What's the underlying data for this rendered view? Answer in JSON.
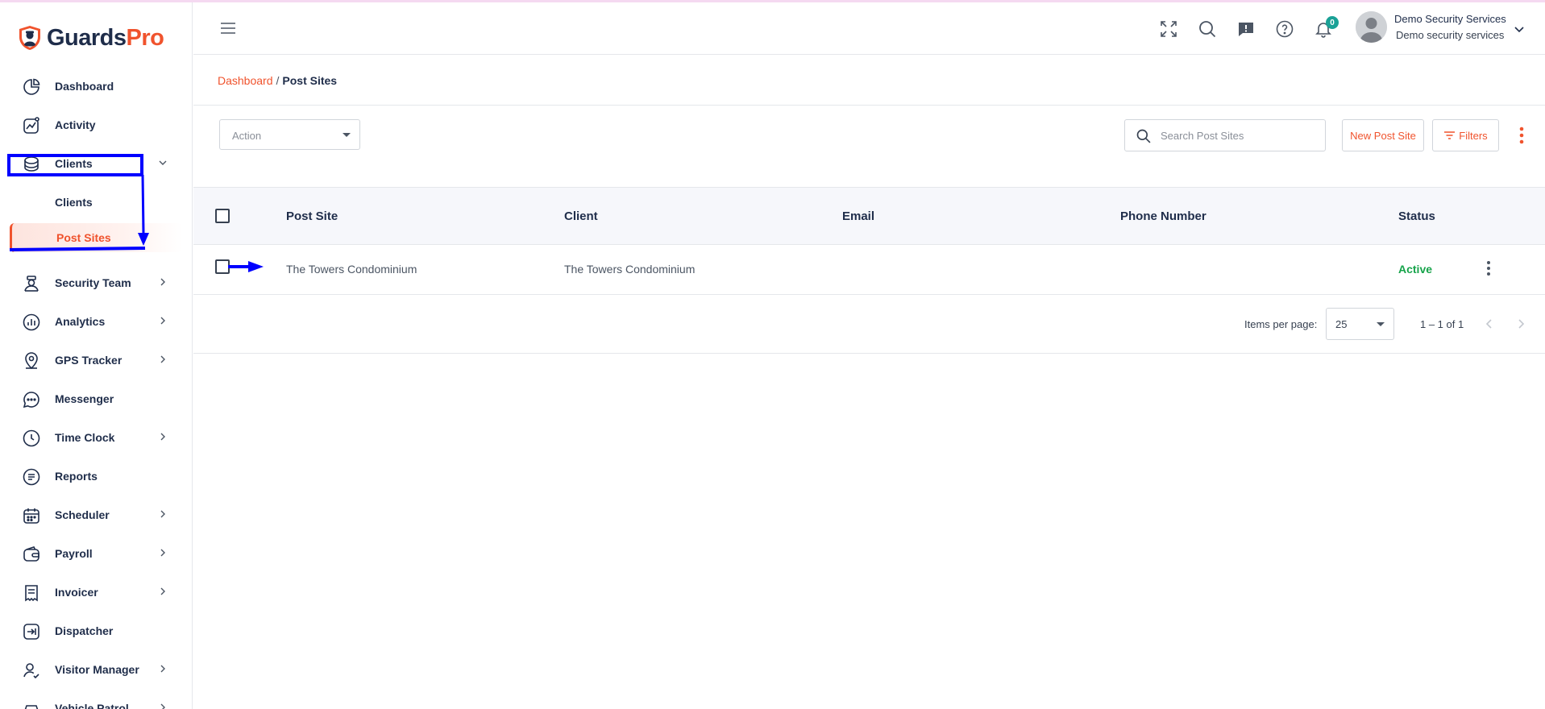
{
  "brand": {
    "name_part1": "Guards",
    "name_part2": "Pro",
    "primary_color": "#f0532d",
    "navy_color": "#1f2d4a"
  },
  "sidebar": {
    "items": [
      {
        "label": "Dashboard",
        "icon": "pie-chart-icon"
      },
      {
        "label": "Activity",
        "icon": "trend-chart-icon"
      },
      {
        "label": "Clients",
        "icon": "database-icon",
        "expanded": true,
        "children": [
          {
            "label": "Clients"
          },
          {
            "label": "Post Sites",
            "active": true
          }
        ]
      },
      {
        "label": "Security Team",
        "icon": "guard-icon"
      },
      {
        "label": "Analytics",
        "icon": "bar-chart-icon"
      },
      {
        "label": "GPS Tracker",
        "icon": "location-pin-icon"
      },
      {
        "label": "Messenger",
        "icon": "chat-bubble-icon"
      },
      {
        "label": "Time Clock",
        "icon": "clock-icon"
      },
      {
        "label": "Reports",
        "icon": "report-doc-icon"
      },
      {
        "label": "Scheduler",
        "icon": "calendar-icon"
      },
      {
        "label": "Payroll",
        "icon": "wallet-icon"
      },
      {
        "label": "Invoicer",
        "icon": "receipt-icon"
      },
      {
        "label": "Dispatcher",
        "icon": "dispatch-icon"
      },
      {
        "label": "Visitor Manager",
        "icon": "visitor-icon"
      },
      {
        "label": "Vehicle Patrol",
        "icon": "car-icon"
      }
    ]
  },
  "header": {
    "notification_count": "0",
    "user": {
      "name": "Demo Security Services",
      "org": "Demo security services"
    }
  },
  "breadcrumb": {
    "parent": "Dashboard",
    "separator": "/",
    "current": "Post Sites"
  },
  "toolbar": {
    "action_placeholder": "Action",
    "search_placeholder": "Search Post Sites",
    "new_button": "New Post Site",
    "filters_button": "Filters"
  },
  "table": {
    "columns": [
      "Post Site",
      "Client",
      "Email",
      "Phone Number",
      "Status"
    ],
    "rows": [
      {
        "post_site": "The Towers Condominium",
        "client": "The Towers Condominium",
        "email": "",
        "phone": "",
        "status": "Active"
      }
    ],
    "status_color": "#16a34a"
  },
  "paginator": {
    "label": "Items per page:",
    "per_page": "25",
    "range": "1 – 1 of 1"
  },
  "annotation_color": "#0000ff"
}
